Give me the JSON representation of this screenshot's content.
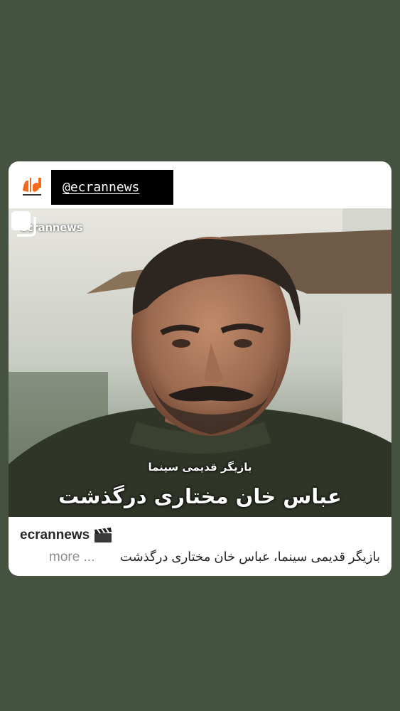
{
  "header": {
    "handle": "@ecrannews",
    "logo_icon": "ekran-logo-icon"
  },
  "post": {
    "watermark": "ecrannews",
    "multi_icon": "carousel-multiple-icon",
    "overlay_small": "بازیگر قدیمی سینما",
    "overlay_big": "عباس خان مختاری درگذشت"
  },
  "caption": {
    "username": "ecrannews",
    "emoji_icon": "clapperboard-icon",
    "text": "بازیگر قدیمی سینما، عباس خان مختاری درگذشت",
    "more_label": "more ..."
  },
  "colors": {
    "background": "#45523f",
    "card": "#ffffff",
    "accent_orange": "#f26b1d"
  }
}
